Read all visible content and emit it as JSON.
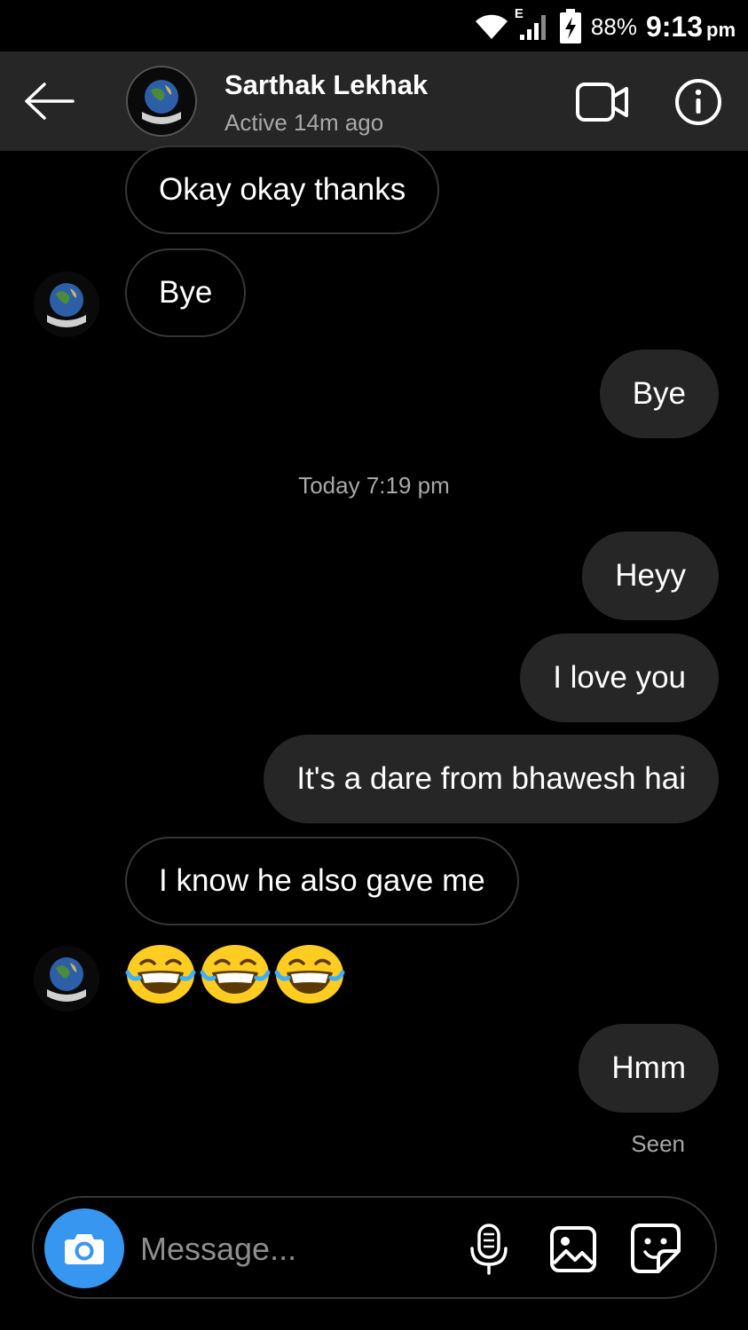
{
  "status_bar": {
    "battery": "88%",
    "time": "9:13",
    "ampm": "pm",
    "network": "E",
    "icons": [
      "wifi-icon",
      "signal-icon",
      "battery-charging-icon"
    ]
  },
  "header": {
    "name": "Sarthak Lekhak",
    "status": "Active 14m ago",
    "icons": [
      "back-arrow-icon",
      "video-call-icon",
      "info-icon"
    ]
  },
  "thread": {
    "messages": [
      {
        "from": "them",
        "text": "Okay okay thanks"
      },
      {
        "from": "them",
        "text": "Bye"
      },
      {
        "from": "me",
        "text": "Bye"
      },
      {
        "from": "me",
        "text": "Heyy"
      },
      {
        "from": "me",
        "text": "I love you"
      },
      {
        "from": "me",
        "text": "It's a dare from bhawesh hai"
      },
      {
        "from": "them",
        "text": "I know he also gave me"
      },
      {
        "from": "them",
        "text": "😂😂😂"
      },
      {
        "from": "me",
        "text": "Hmm"
      }
    ],
    "timestamp": "Today 7:19 pm",
    "seen": "Seen"
  },
  "composer": {
    "placeholder": "Message...",
    "icons": [
      "camera-icon",
      "microphone-icon",
      "gallery-icon",
      "sticker-icon"
    ]
  },
  "colors": {
    "background": "#000000",
    "header_bg": "#262626",
    "outgoing_bubble": "#262626",
    "incoming_border": "#363636",
    "secondary_text": "#a8a8a8",
    "camera_button": "#3797f0",
    "emoji_yellow": "#ffcc22"
  }
}
